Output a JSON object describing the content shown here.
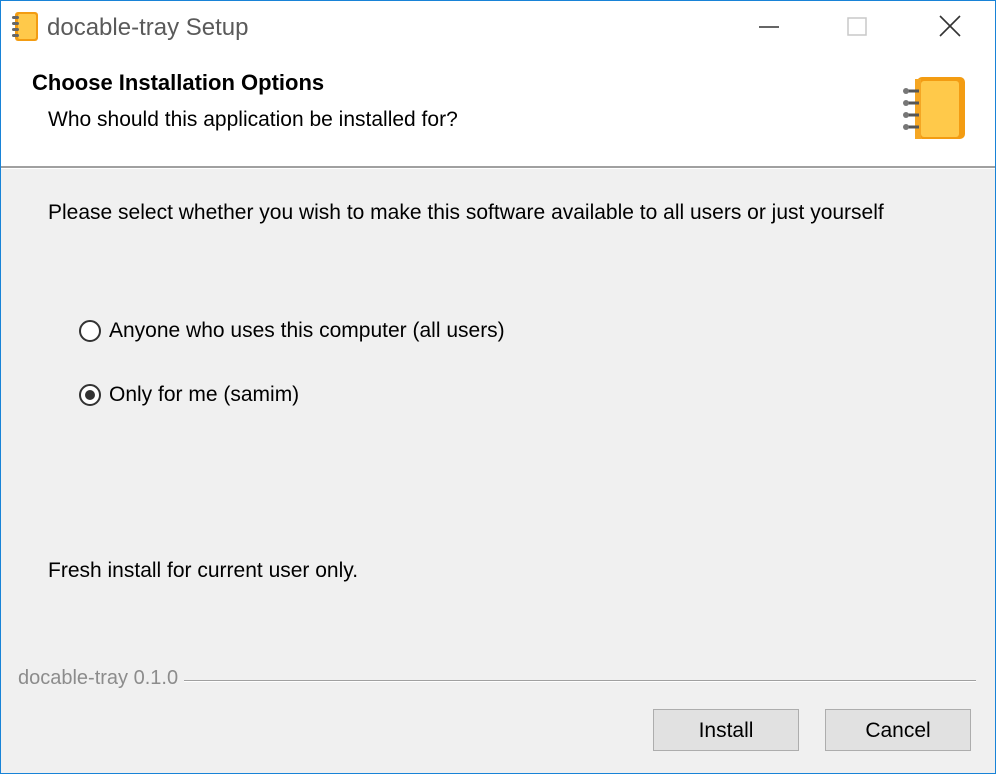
{
  "window": {
    "title": "docable-tray Setup",
    "icons": {
      "app": "notebook-icon",
      "minimize": "minimize-icon",
      "maximize": "maximize-icon",
      "close": "close-icon"
    }
  },
  "header": {
    "title": "Choose Installation Options",
    "subtitle": "Who should this application be installed for?",
    "icon": "notebook-icon"
  },
  "body": {
    "instruction": "Please select whether you wish to make this software available to all users or just yourself",
    "options": [
      {
        "label": "Anyone who uses this computer (all users)",
        "selected": false
      },
      {
        "label": "Only for me (samim)",
        "selected": true
      }
    ],
    "status": "Fresh install for current user only."
  },
  "footer": {
    "branding": "docable-tray 0.1.0",
    "install_label": "Install",
    "cancel_label": "Cancel"
  },
  "colors": {
    "accent_border": "#1883d7",
    "icon_orange": "#f39c12",
    "icon_yellow": "#ffc94a",
    "dialog_background": "#f0f0f0"
  }
}
